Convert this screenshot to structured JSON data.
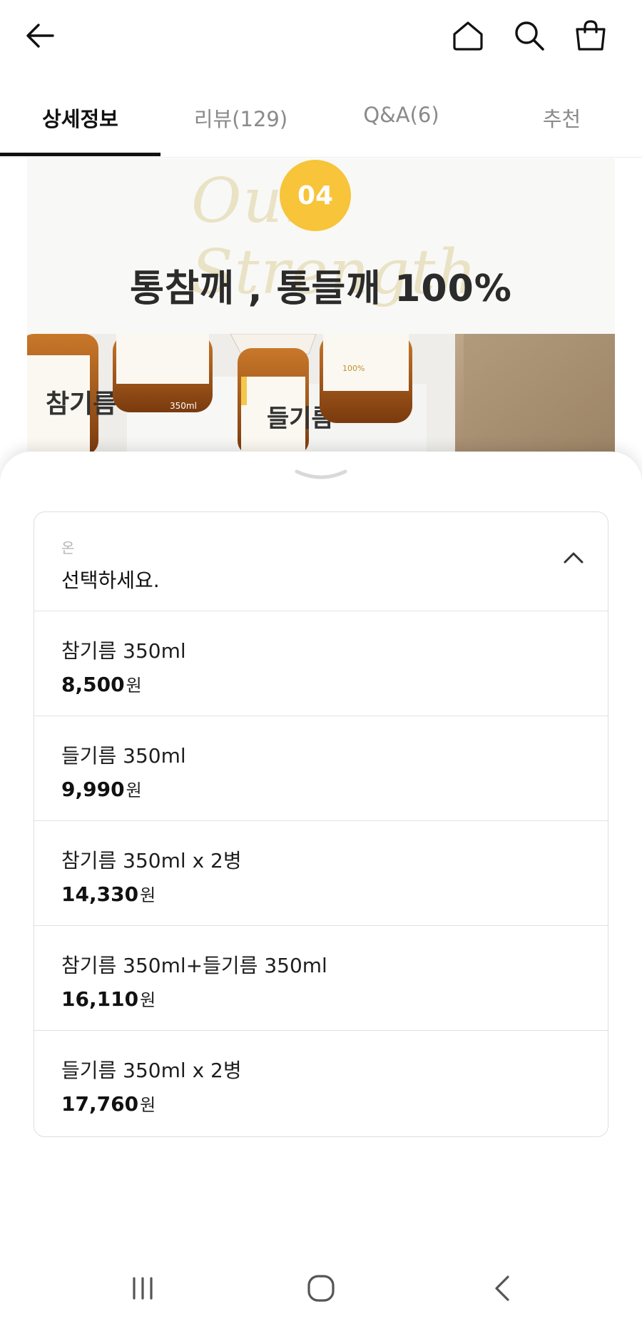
{
  "header": {
    "back_icon": "arrow-left-icon",
    "home_icon": "home-icon",
    "search_icon": "search-icon",
    "cart_icon": "shopping-bag-icon"
  },
  "tabs": [
    {
      "label": "상세정보",
      "active": true
    },
    {
      "label": "리뷰(129)",
      "active": false
    },
    {
      "label": "Q&A(6)",
      "active": false
    },
    {
      "label": "추천",
      "active": false
    }
  ],
  "banner": {
    "badge": "04",
    "script_text": "Our Strength",
    "headline": "통참깨 , 통들깨 100%"
  },
  "product_photo": {
    "bottle_labels": [
      "참기름",
      "들기름"
    ],
    "volume": "350ml",
    "bottle_note": "100%"
  },
  "option_sheet": {
    "label": "온",
    "placeholder": "선택하세요.",
    "options": [
      {
        "name": "참기름 350ml",
        "price": "8,500",
        "currency": "원"
      },
      {
        "name": "들기름 350ml",
        "price": "9,990",
        "currency": "원"
      },
      {
        "name": "참기름 350ml x 2병",
        "price": "14,330",
        "currency": "원"
      },
      {
        "name": "참기름 350ml+들기름 350ml",
        "price": "16,110",
        "currency": "원"
      },
      {
        "name": "들기름 350ml x 2병",
        "price": "17,760",
        "currency": "원"
      }
    ]
  },
  "system_nav": {
    "recents_icon": "recent-apps-icon",
    "home_icon": "system-home-icon",
    "back_icon": "system-back-icon"
  },
  "colors": {
    "badge": "#f7c43a",
    "tab_indicator": "#111111",
    "border": "#e2e2e2"
  }
}
